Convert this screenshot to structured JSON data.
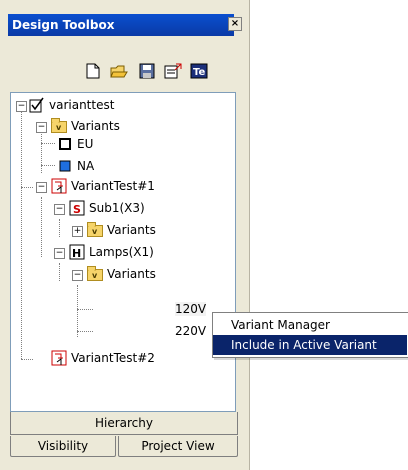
{
  "window": {
    "title": "Design Toolbox",
    "close": "×"
  },
  "toolbar": {
    "buttons": [
      {
        "name": "new-icon"
      },
      {
        "name": "open-folder-icon"
      },
      {
        "name": "save-icon"
      },
      {
        "name": "export-icon"
      },
      {
        "name": "text-editor-icon"
      }
    ]
  },
  "tree": {
    "root": "varianttest",
    "variants_folder": "Variants",
    "variant_eu": "EU",
    "variant_na": "NA",
    "vt1": "VariantTest#1",
    "sub1": "Sub1(X3)",
    "sub1_variants": "Variants",
    "lamps": "Lamps(X1)",
    "lamps_variants": "Variants",
    "v120": "120V",
    "v220": "220V",
    "vt2": "VariantTest#2",
    "expander_minus": "−",
    "expander_plus": "+"
  },
  "tabs": {
    "hierarchy": "Hierarchy",
    "visibility": "Visibility",
    "project_view": "Project View"
  },
  "context_menu": {
    "items": [
      "Variant Manager",
      "Include in Active Variant"
    ],
    "highlighted_index": 1,
    "highlight_color": "#0a246a"
  },
  "colors": {
    "title_bar": "#0a46c4",
    "panel": "#ece9d8",
    "na_swatch": "#1f6fe0"
  }
}
